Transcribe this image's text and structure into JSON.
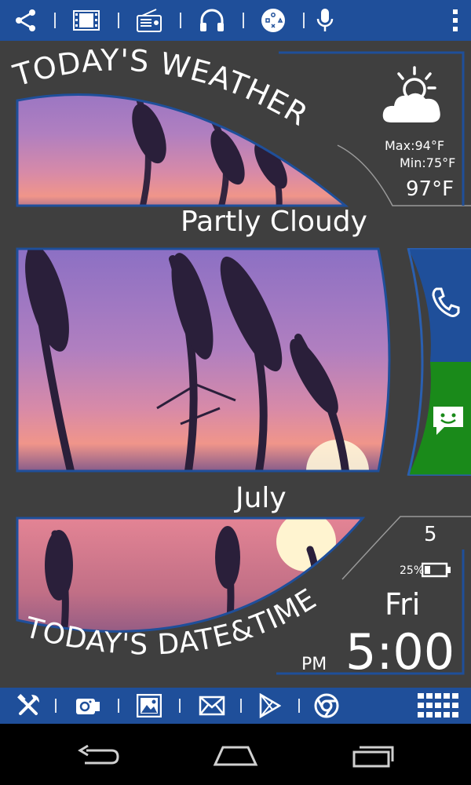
{
  "top_toolbar": {
    "icons": [
      "share-icon",
      "film-icon",
      "radio-icon",
      "headphones-icon",
      "gamepad-icon",
      "microphone-icon",
      "overflow-menu-icon"
    ]
  },
  "weather": {
    "title": "TODAY'S WEATHER",
    "condition": "Partly Cloudy",
    "max": "Max:94°F",
    "min": "Min:75°F",
    "current_temp": "97°F",
    "icon": "partly-cloudy-icon"
  },
  "calendar": {
    "month": "July",
    "day_number": "5",
    "weekday": "Fri",
    "time": "5:00",
    "ampm": "PM",
    "battery": "25%",
    "title": "TODAY'S DATE&TIME"
  },
  "side_tiles": {
    "phone_color": "#1f4f9a",
    "messages_color": "#1a8a1a"
  },
  "bottom_toolbar": {
    "icons": [
      "tools-icon",
      "camera-icon",
      "gallery-icon",
      "email-icon",
      "play-store-icon",
      "chrome-icon",
      "app-grid-icon"
    ]
  },
  "nav": {
    "icons": [
      "back-icon",
      "home-icon",
      "recents-icon"
    ]
  },
  "colors": {
    "accent": "#1f4f9a",
    "panel": "#3f3f3f",
    "green": "#1a8a1a"
  }
}
